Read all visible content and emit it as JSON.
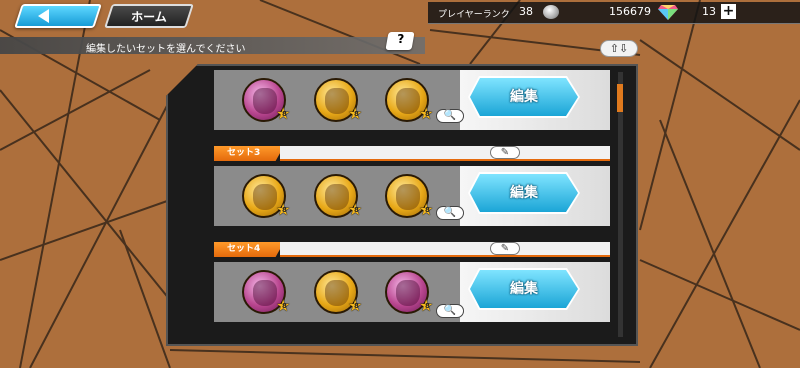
{
  "header": {
    "home_label": "ホーム",
    "rank_label": "プレイヤーランク",
    "rank_value": "38",
    "coins": "156679",
    "gems": "13",
    "plus": "+"
  },
  "instruction": {
    "text": "編集したいセットを選んでください",
    "help_label": "?",
    "sort_label": "⇧⇩"
  },
  "sets": [
    {
      "label": "",
      "edit_label": "編集",
      "medals": [
        {
          "color": "pink",
          "level": "8"
        },
        {
          "color": "gold",
          "level": "8"
        },
        {
          "color": "gold",
          "level": "8"
        }
      ]
    },
    {
      "label": "セット3",
      "edit_label": "編集",
      "medals": [
        {
          "color": "gold",
          "level": "8"
        },
        {
          "color": "gold",
          "level": "8"
        },
        {
          "color": "gold",
          "level": "8"
        }
      ]
    },
    {
      "label": "セット4",
      "edit_label": "編集",
      "medals": [
        {
          "color": "pink",
          "level": "8"
        },
        {
          "color": "gold",
          "level": "8"
        },
        {
          "color": "pink",
          "level": "8"
        }
      ]
    }
  ],
  "colors": {
    "accent_orange": "#e46a0c",
    "button_blue": "#1ba5d6",
    "background": "#d4884a"
  }
}
